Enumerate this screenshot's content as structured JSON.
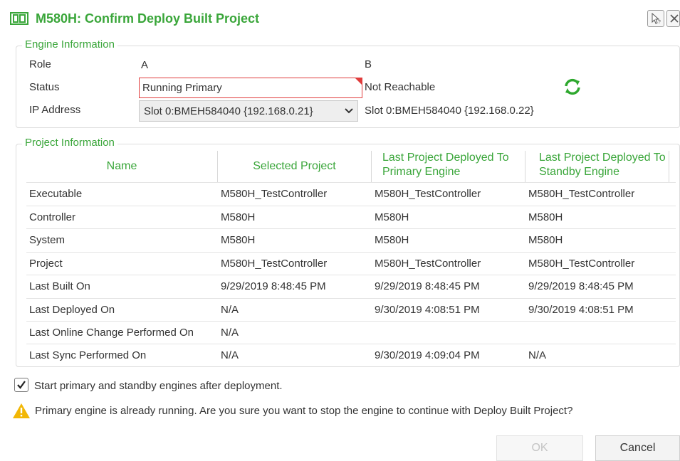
{
  "window": {
    "title": "M580H: Confirm Deploy Built Project"
  },
  "engine_info": {
    "legend": "Engine Information",
    "role_label": "Role",
    "role_a": "A",
    "role_b": "B",
    "status_label": "Status",
    "status_a": "Running Primary",
    "status_b": "Not Reachable",
    "ip_label": "IP Address",
    "ip_a": "Slot 0:BMEH584040 {192.168.0.21}",
    "ip_b": "Slot 0:BMEH584040 {192.168.0.22}"
  },
  "project_info": {
    "legend": "Project Information",
    "headers": [
      "Name",
      "Selected Project",
      "Last Project Deployed To Primary Engine",
      "Last Project Deployed To Standby Engine"
    ],
    "rows": [
      [
        "Executable",
        "M580H_TestController",
        "M580H_TestController",
        "M580H_TestController"
      ],
      [
        "Controller",
        "M580H",
        "M580H",
        "M580H"
      ],
      [
        "System",
        "M580H",
        "M580H",
        "M580H"
      ],
      [
        "Project",
        "M580H_TestController",
        "M580H_TestController",
        "M580H_TestController"
      ],
      [
        "Last Built On",
        "9/29/2019 8:48:45 PM",
        "9/29/2019 8:48:45 PM",
        "9/29/2019 8:48:45 PM"
      ],
      [
        "Last Deployed On",
        "N/A",
        "9/30/2019 4:08:51 PM",
        "9/30/2019 4:08:51 PM"
      ],
      [
        "Last Online Change Performed On",
        "N/A",
        "",
        ""
      ],
      [
        "Last Sync Performed On",
        "N/A",
        "9/30/2019 4:09:04 PM",
        "N/A"
      ]
    ]
  },
  "footer": {
    "checkbox_label": "Start primary and standby engines after deployment.",
    "warning": "Primary engine is already running. Are you sure you want to stop the engine to continue with Deploy Built Project?",
    "ok_label": "OK",
    "cancel_label": "Cancel"
  },
  "colors": {
    "accent": "#3aa63a",
    "error_border": "#e03c3c",
    "warning": "#f2b705"
  }
}
